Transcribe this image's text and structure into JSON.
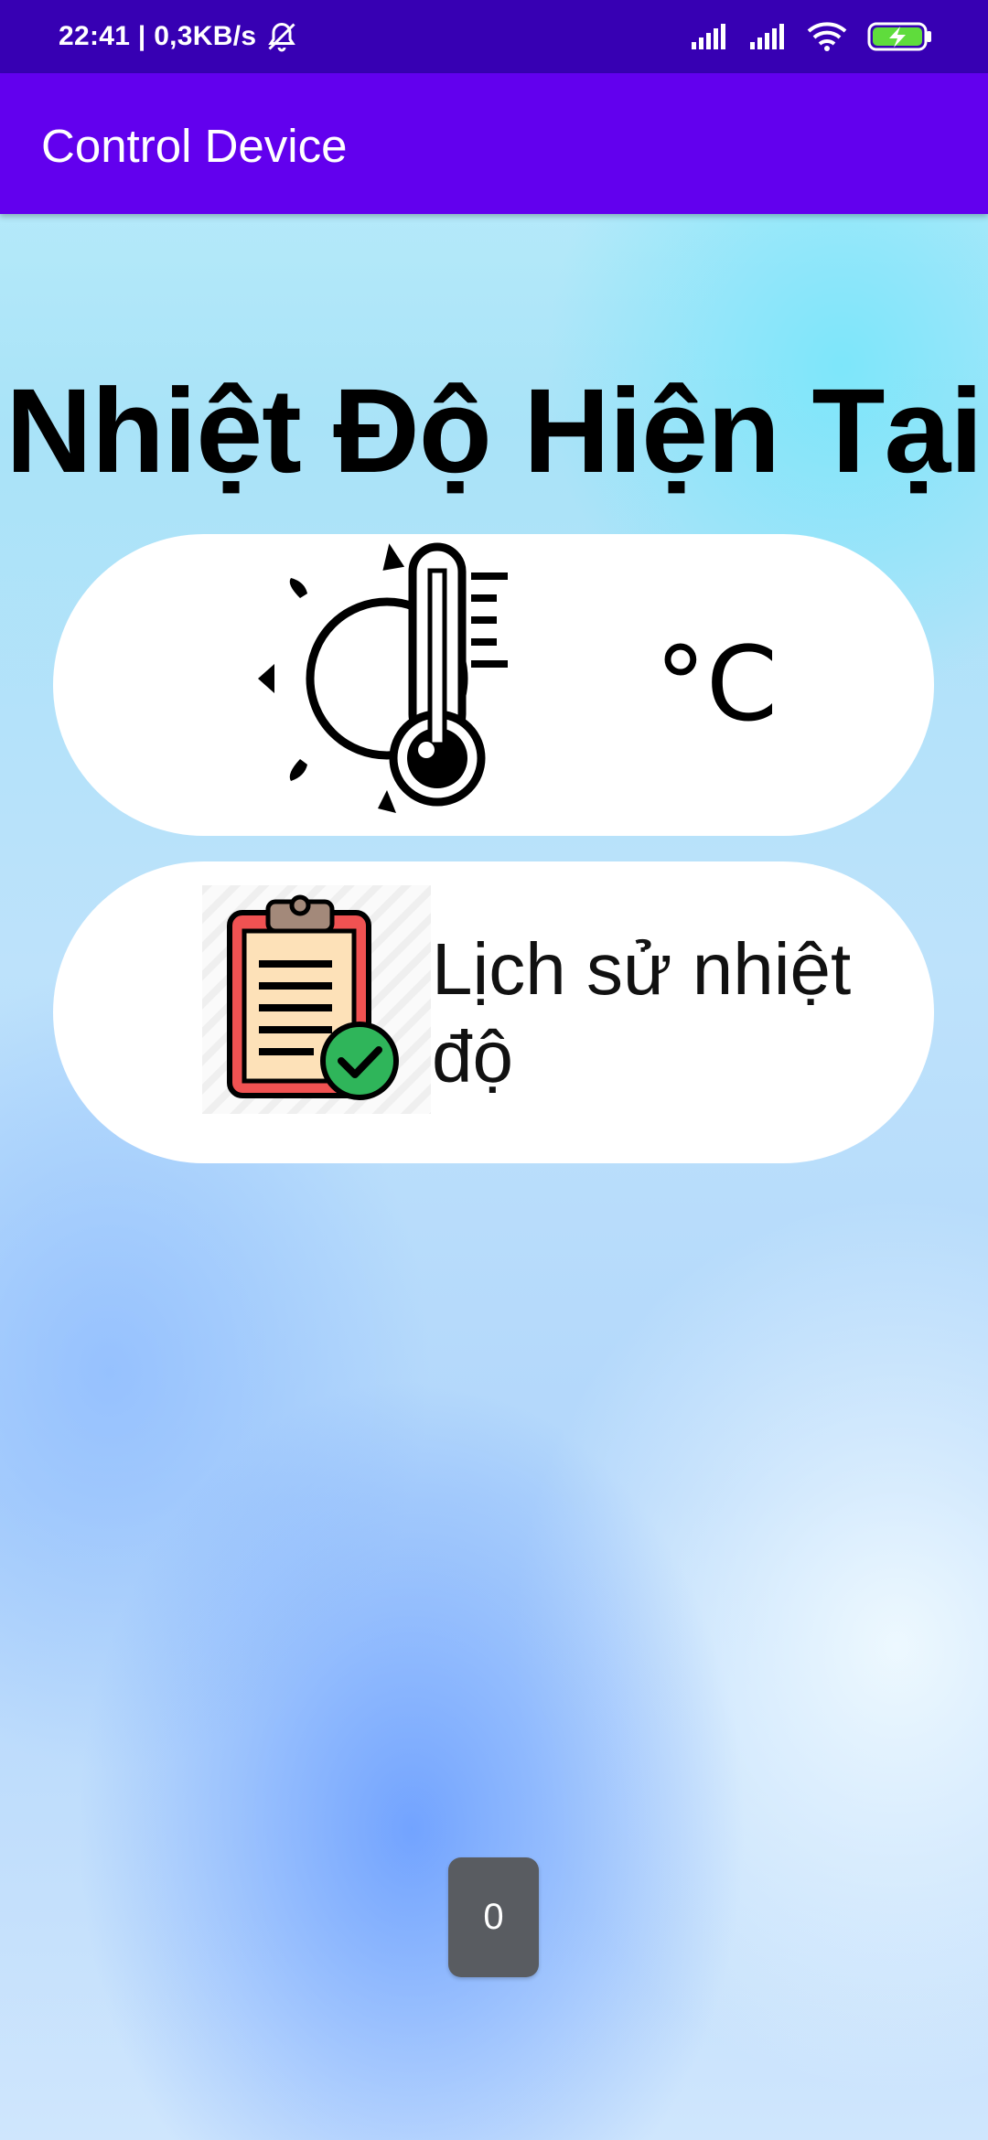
{
  "status_bar": {
    "time_speed": "22:41 | 0,3KB/s",
    "icons": [
      "bell-off-icon",
      "signal-icon",
      "signal-icon",
      "wifi-icon",
      "battery-charging-icon"
    ]
  },
  "app_bar": {
    "title": "Control Device"
  },
  "main": {
    "heading": "Nhiệt Độ Hiện Tại",
    "temperature_card": {
      "icon": "thermometer-sun-icon",
      "unit": "°C"
    },
    "history_card": {
      "icon": "clipboard-check-icon",
      "label": "Lịch sử nhiệt độ"
    }
  },
  "toast": {
    "text": "0"
  },
  "colors": {
    "status_bar": "#3700b3",
    "app_bar": "#6200ee",
    "card": "#ffffff",
    "toast": "#595c61"
  }
}
